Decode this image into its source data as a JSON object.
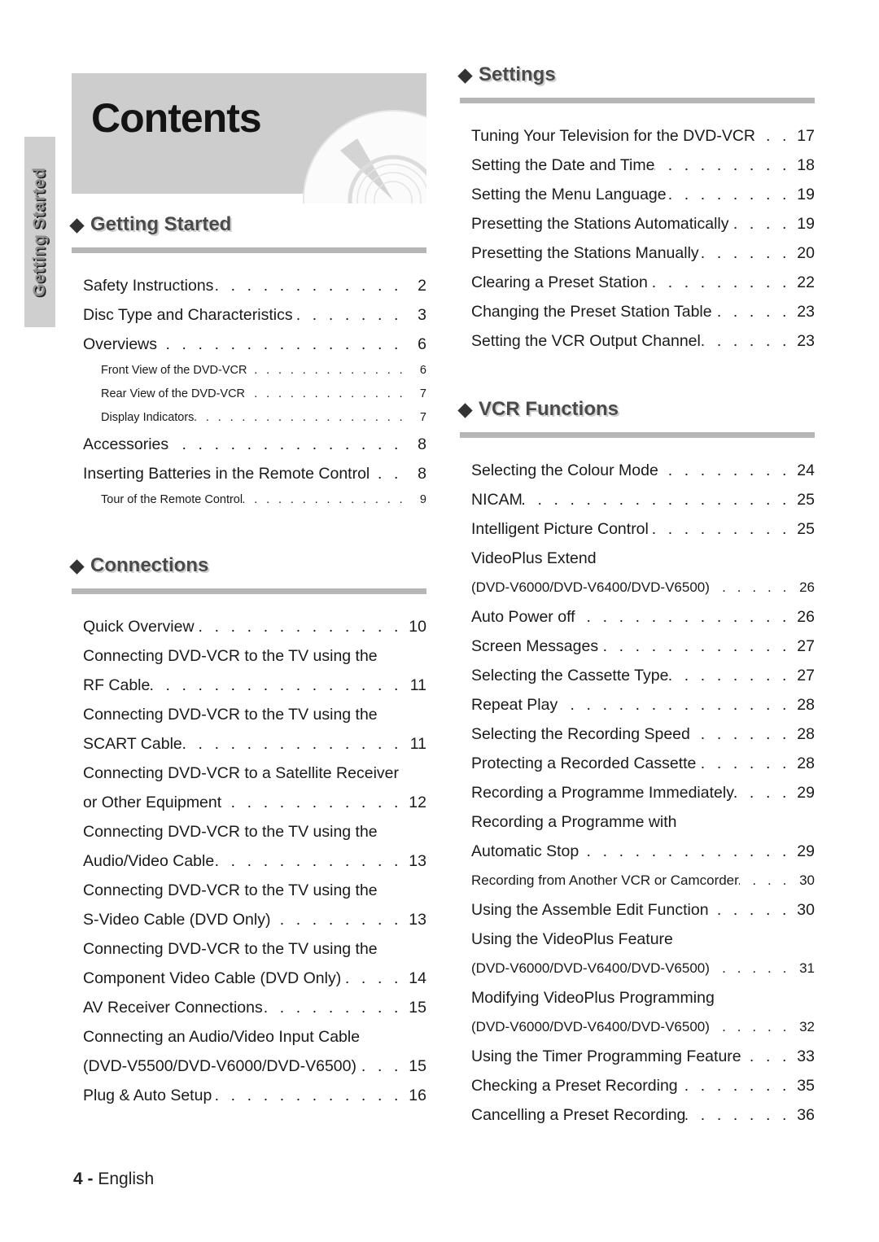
{
  "page": {
    "title": "Contents",
    "side_tab_label": "Getting Started",
    "footer_number": "4 -",
    "footer_language": "English",
    "colors": {
      "header_band": "#cdcdcd",
      "section_rule": "#b6b6b6",
      "section_title": "#4a4a4a",
      "side_tab_bg": "#cfcfcf"
    }
  },
  "sections": [
    {
      "id": "getting-started",
      "title": "Getting Started",
      "column": "left",
      "entries": [
        {
          "label": "Safety Instructions",
          "page": "2",
          "level": "main"
        },
        {
          "label": "Disc Type and Characteristics",
          "page": "3",
          "level": "main"
        },
        {
          "label": "Overviews",
          "page": "6",
          "level": "main"
        },
        {
          "label": "Front View of the DVD-VCR",
          "page": "6",
          "level": "sub"
        },
        {
          "label": "Rear View of the DVD-VCR",
          "page": "7",
          "level": "sub"
        },
        {
          "label": "Display Indicators",
          "page": "7",
          "level": "sub"
        },
        {
          "label": "Accessories",
          "page": "8",
          "level": "main"
        },
        {
          "label": "Inserting Batteries in the Remote Control",
          "page": "8",
          "level": "main"
        },
        {
          "label": "Tour of the Remote Control",
          "page": "9",
          "level": "sub"
        }
      ]
    },
    {
      "id": "connections",
      "title": "Connections",
      "column": "left",
      "entries": [
        {
          "label": "Quick Overview",
          "page": "10",
          "level": "main"
        },
        {
          "label": "Connecting DVD-VCR to the TV using the",
          "page": "",
          "level": "cont"
        },
        {
          "label": "RF Cable",
          "page": "11",
          "level": "main"
        },
        {
          "label": "Connecting DVD-VCR to the TV using the",
          "page": "",
          "level": "cont"
        },
        {
          "label": "SCART Cable",
          "page": "11",
          "level": "main"
        },
        {
          "label": "Connecting DVD-VCR to a Satellite Receiver",
          "page": "",
          "level": "cont"
        },
        {
          "label": "or Other Equipment",
          "page": "12",
          "level": "main"
        },
        {
          "label": "Connecting DVD-VCR to the TV using the",
          "page": "",
          "level": "cont"
        },
        {
          "label": "Audio/Video Cable",
          "page": "13",
          "level": "main"
        },
        {
          "label": "Connecting DVD-VCR to the TV using the",
          "page": "",
          "level": "cont"
        },
        {
          "label": "S-Video Cable (DVD Only)",
          "page": "13",
          "level": "main"
        },
        {
          "label": "Connecting DVD-VCR to the TV using the",
          "page": "",
          "level": "cont"
        },
        {
          "label": "Component Video Cable (DVD Only)",
          "page": "14",
          "level": "main"
        },
        {
          "label": "AV Receiver Connections",
          "page": "15",
          "level": "main"
        },
        {
          "label": "Connecting an Audio/Video Input Cable",
          "page": "",
          "level": "cont"
        },
        {
          "label": "(DVD-V5500/DVD-V6000/DVD-V6500)",
          "page": "15",
          "level": "main"
        },
        {
          "label": "Plug & Auto Setup",
          "page": "16",
          "level": "main"
        }
      ]
    },
    {
      "id": "settings",
      "title": "Settings",
      "column": "right",
      "entries": [
        {
          "label": "Tuning Your Television for the DVD-VCR",
          "page": "17",
          "level": "main"
        },
        {
          "label": "Setting the Date and Time",
          "page": "18",
          "level": "main"
        },
        {
          "label": "Setting the Menu Language",
          "page": "19",
          "level": "main"
        },
        {
          "label": "Presetting the Stations Automatically",
          "page": "19",
          "level": "main"
        },
        {
          "label": "Presetting the Stations Manually",
          "page": "20",
          "level": "main"
        },
        {
          "label": "Clearing a Preset Station",
          "page": "22",
          "level": "main"
        },
        {
          "label": "Changing the Preset Station Table",
          "page": "23",
          "level": "main"
        },
        {
          "label": "Setting the VCR Output Channel",
          "page": "23",
          "level": "main"
        }
      ]
    },
    {
      "id": "vcr-functions",
      "title": "VCR Functions",
      "column": "right",
      "entries": [
        {
          "label": "Selecting the Colour Mode",
          "page": "24",
          "level": "main"
        },
        {
          "label": "NICAM",
          "page": "25",
          "level": "main"
        },
        {
          "label": "Intelligent Picture Control",
          "page": "25",
          "level": "main"
        },
        {
          "label": "VideoPlus Extend",
          "page": "",
          "level": "cont"
        },
        {
          "label": "(DVD-V6000/DVD-V6400/DVD-V6500)",
          "page": "26",
          "level": "small"
        },
        {
          "label": "Auto Power off",
          "page": "26",
          "level": "main"
        },
        {
          "label": "Screen Messages",
          "page": "27",
          "level": "main"
        },
        {
          "label": "Selecting the Cassette Type",
          "page": "27",
          "level": "main"
        },
        {
          "label": "Repeat Play",
          "page": "28",
          "level": "main"
        },
        {
          "label": "Selecting the Recording Speed",
          "page": "28",
          "level": "main"
        },
        {
          "label": "Protecting a Recorded Cassette",
          "page": "28",
          "level": "main"
        },
        {
          "label": "Recording a Programme Immediately",
          "page": "29",
          "level": "main"
        },
        {
          "label": "Recording a Programme with",
          "page": "",
          "level": "cont"
        },
        {
          "label": "Automatic Stop",
          "page": "29",
          "level": "main"
        },
        {
          "label": "Recording from Another VCR or Camcorder",
          "page": "30",
          "level": "small"
        },
        {
          "label": "Using the Assemble Edit Function",
          "page": "30",
          "level": "main"
        },
        {
          "label": "Using the VideoPlus Feature",
          "page": "",
          "level": "cont"
        },
        {
          "label": "(DVD-V6000/DVD-V6400/DVD-V6500)",
          "page": "31",
          "level": "small"
        },
        {
          "label": "Modifying VideoPlus Programming",
          "page": "",
          "level": "cont"
        },
        {
          "label": "(DVD-V6000/DVD-V6400/DVD-V6500)",
          "page": "32",
          "level": "small"
        },
        {
          "label": "Using the Timer Programming Feature",
          "page": "33",
          "level": "main"
        },
        {
          "label": "Checking a Preset Recording",
          "page": "35",
          "level": "main"
        },
        {
          "label": "Cancelling a Preset Recording",
          "page": "36",
          "level": "main"
        }
      ]
    }
  ]
}
